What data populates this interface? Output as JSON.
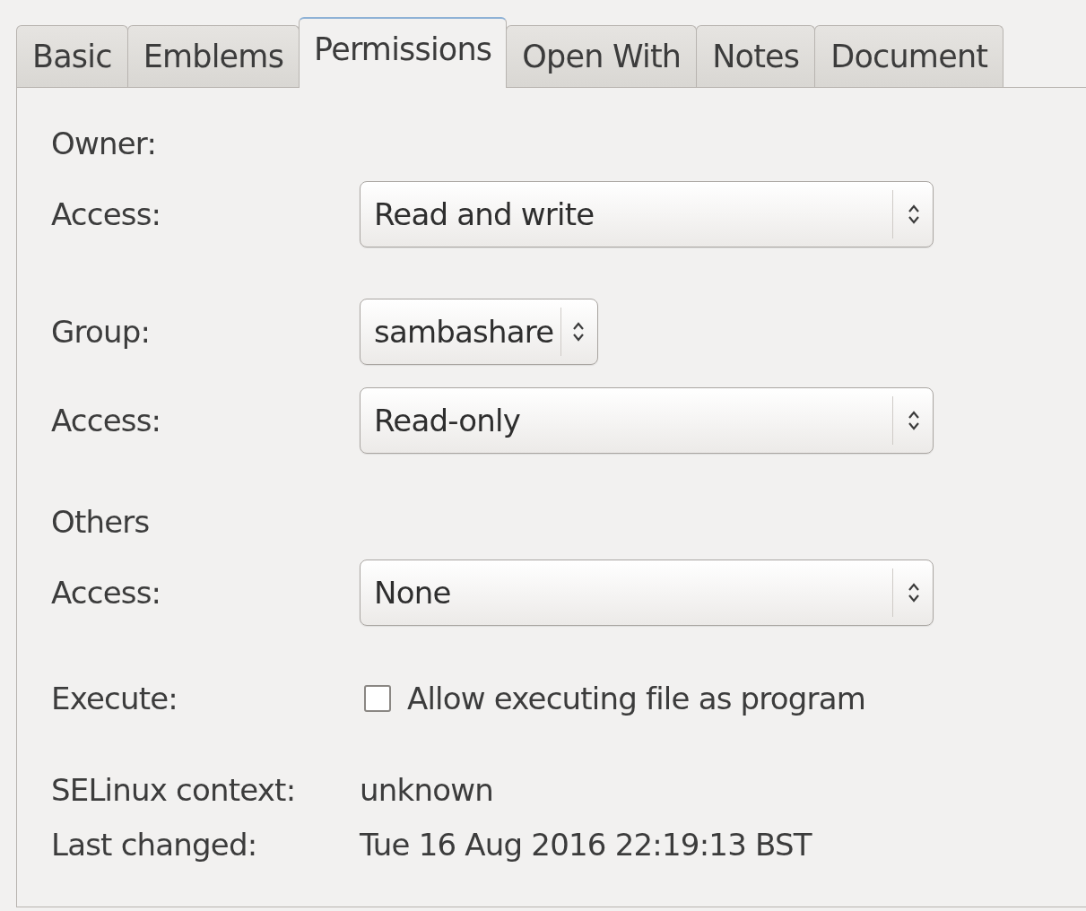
{
  "tabs": [
    {
      "label": "Basic",
      "selected": false
    },
    {
      "label": "Emblems",
      "selected": false
    },
    {
      "label": "Permissions",
      "selected": true
    },
    {
      "label": "Open With",
      "selected": false
    },
    {
      "label": "Notes",
      "selected": false
    },
    {
      "label": "Document",
      "selected": false
    }
  ],
  "rows": [
    {
      "kind": "heading",
      "label": "Owner:"
    },
    {
      "kind": "combo",
      "label": "Access:",
      "value": "Read and write",
      "stretch": true
    },
    {
      "kind": "combo",
      "label": "Group:",
      "value": "sambashare",
      "stretch": false
    },
    {
      "kind": "combo",
      "label": "Access:",
      "value": "Read-only",
      "stretch": true
    },
    {
      "kind": "heading",
      "label": "Others"
    },
    {
      "kind": "combo",
      "label": "Access:",
      "value": "None",
      "stretch": true
    },
    {
      "kind": "checkbox",
      "label": "Execute:",
      "text": "Allow executing file as program",
      "checked": false
    },
    {
      "kind": "info",
      "label": "SELinux context:",
      "value": "unknown"
    },
    {
      "kind": "info",
      "label": "Last changed:",
      "value": "Tue 16 Aug 2016 22:19:13 BST"
    }
  ]
}
